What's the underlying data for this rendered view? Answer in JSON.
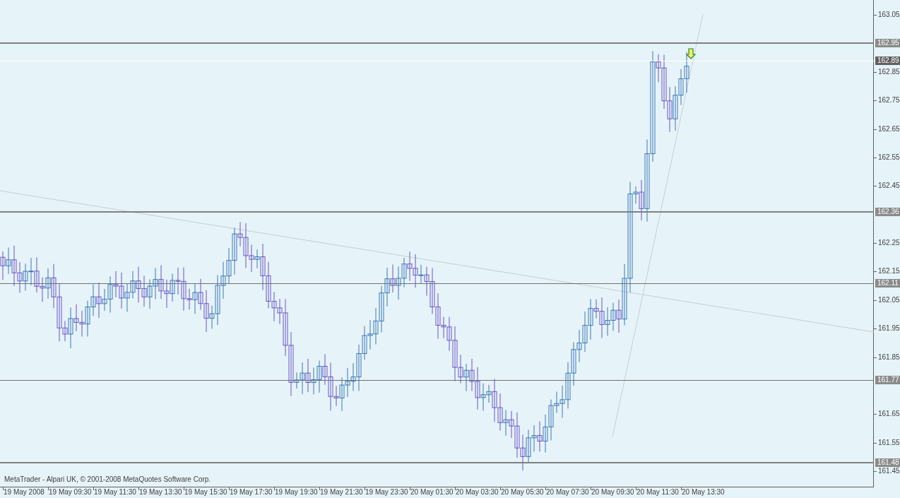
{
  "chart": {
    "price_axis": [
      "163.05",
      "162.85",
      "162.75",
      "162.65",
      "162.55",
      "162.45",
      "162.25",
      "162.15",
      "162.05",
      "161.95",
      "161.85",
      "161.65",
      "161.55",
      "161.45"
    ],
    "time_axis": [
      "19 May 2008",
      "19 May 09:30",
      "19 May 11:30",
      "19 May 13:30",
      "19 May 15:30",
      "19 May 17:30",
      "19 May 19:30",
      "19 May 21:30",
      "19 May 23:30",
      "20 May 01:30",
      "20 May 03:30",
      "20 May 05:30",
      "20 May 07:30",
      "20 May 09:30",
      "20 May 11:30",
      "20 May 13:30"
    ],
    "levels": [
      {
        "kind": "line",
        "label": "162.95"
      },
      {
        "kind": "bid",
        "label": "162.89"
      },
      {
        "kind": "line",
        "label": "162.36"
      },
      {
        "kind": "thin",
        "label": "162.11"
      },
      {
        "kind": "thin",
        "label": "161.77"
      },
      {
        "kind": "line",
        "label": "161.48"
      }
    ],
    "credit": "MetaTrader - Alpari UK, © 2001-2008 MetaQuotes Software Corp."
  }
}
